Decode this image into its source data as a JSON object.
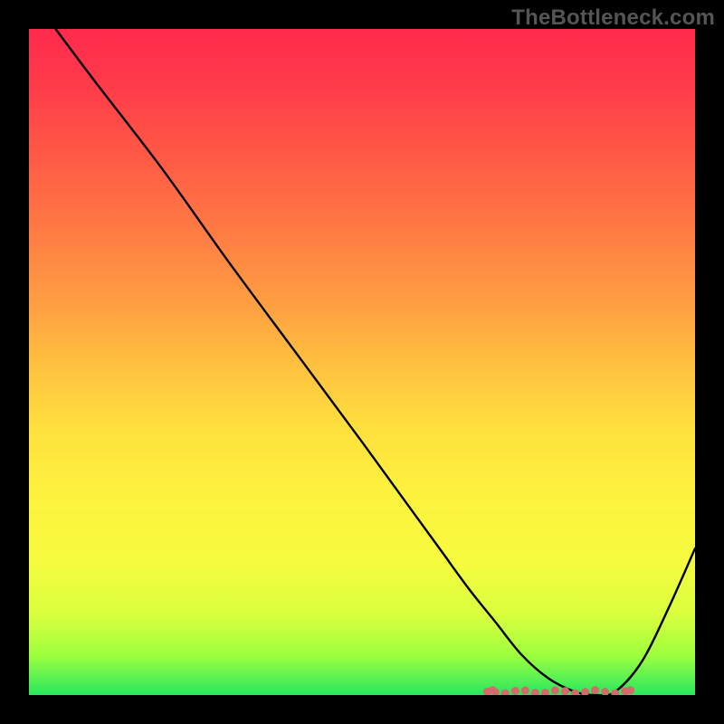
{
  "watermark": "TheBottleneck.com",
  "colors": {
    "curve_stroke": "#000000",
    "flat_dot": "#d46a6a",
    "background_black": "#000000"
  },
  "chart_data": {
    "type": "line",
    "title": "",
    "xlabel": "",
    "ylabel": "",
    "xlim": [
      0,
      100
    ],
    "ylim": [
      0,
      100
    ],
    "annotations": [],
    "series": [
      {
        "name": "curve",
        "x": [
          4,
          10,
          20,
          30,
          40,
          50,
          58,
          62,
          66,
          70,
          74,
          78,
          82,
          85,
          88,
          92,
          96,
          100
        ],
        "y": [
          100,
          92,
          79,
          65,
          51.5,
          38,
          27,
          21.5,
          16,
          11,
          6,
          2.5,
          0.5,
          0,
          0.5,
          5,
          13,
          22
        ]
      }
    ],
    "flat_segment": {
      "comment": "pink dotted segment near the minimum of the curve",
      "x_range": [
        70,
        89
      ],
      "y": 0.5,
      "dot_spacing_x": 1.5
    }
  }
}
